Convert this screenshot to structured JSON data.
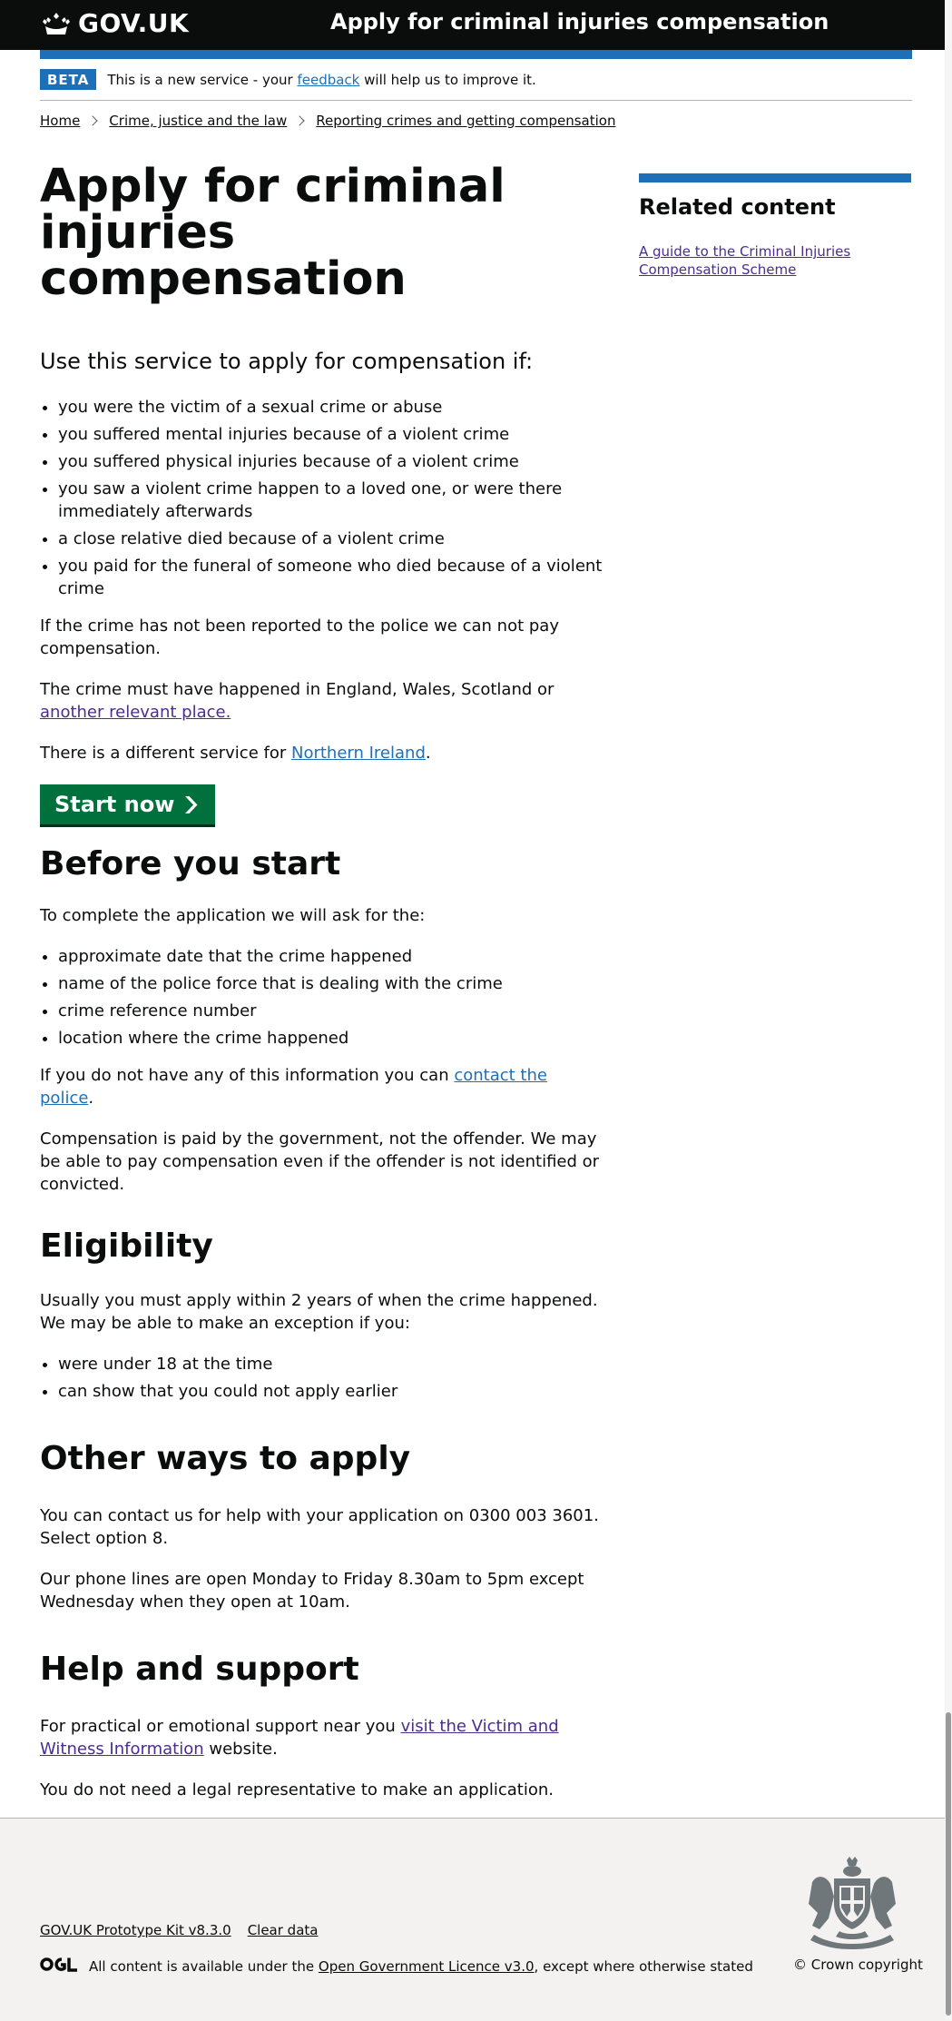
{
  "header": {
    "logo_text": "GOV.UK",
    "service_name": "Apply for criminal injuries compensation"
  },
  "phase_banner": {
    "tag": "BETA",
    "text_before": "This is a new service - your",
    "link": "feedback",
    "text_after": "will help us to improve it."
  },
  "breadcrumbs": [
    "Home",
    "Crime, justice and the law",
    "Reporting crimes and getting compensation"
  ],
  "main": {
    "title": "Apply for criminal injuries compensation",
    "lead": "Use this service to apply for compensation if:",
    "conditions": [
      "you were the victim of a sexual crime or abuse",
      "you suffered mental injuries because of a violent crime",
      "you suffered physical injuries because of a violent crime",
      "you saw a violent crime happen to a loved one, or were there immediately afterwards",
      "a close relative died because of a violent crime",
      "you paid for the funeral of someone who died because of a violent crime"
    ],
    "not_reported": "If the crime has not been reported to the police we can not pay compensation.",
    "location_text": "The crime must have happened in England, Wales, Scotland or",
    "location_link": "another relevant place.",
    "ni_text": "There is a different service for",
    "ni_link": "Northern Ireland",
    "ni_end": ".",
    "start_button": "Start now",
    "before": {
      "heading": "Before you start",
      "intro": "To complete the application we will ask for the:",
      "items": [
        "approximate date that the crime happened",
        "name of the police force that is dealing with the crime",
        "crime reference number",
        "location where the crime happened"
      ],
      "police_text": "If you do not have any of this information you can",
      "police_link": "contact the police",
      "police_end": ".",
      "paid_text": "Compensation is paid by the government, not the offender. We may be able to pay compensation even if the offender is not identified or convicted."
    },
    "eligibility": {
      "heading": "Eligibility",
      "intro": "Usually you must apply within 2 years of when the crime happened. We may be able to make an exception if you:",
      "items": [
        "were under 18 at the time",
        "can show that you could not apply earlier"
      ]
    },
    "other_ways": {
      "heading": "Other ways to apply",
      "phone": "You can contact us for help with your application on 0300 003 3601. Select option 8.",
      "hours": "Our phone lines are open Monday to Friday 8.30am to 5pm except Wednesday when they open at 10am."
    },
    "help": {
      "heading": "Help and support",
      "support_text": "For practical or emotional support near you",
      "support_link": "visit the Victim and Witness Information",
      "support_end": "website.",
      "legal_text": "You do not need a legal representative to make an application."
    }
  },
  "sidebar": {
    "heading": "Related content",
    "link": "A guide to the Criminal Injuries Compensation Scheme"
  },
  "footer": {
    "links": [
      "GOV.UK Prototype Kit v8.3.0",
      "Clear data"
    ],
    "licence_text": "All content is available under the",
    "licence_link": "Open Government Licence v3.0",
    "licence_end": ", except where otherwise stated",
    "copyright": "© Crown copyright"
  }
}
